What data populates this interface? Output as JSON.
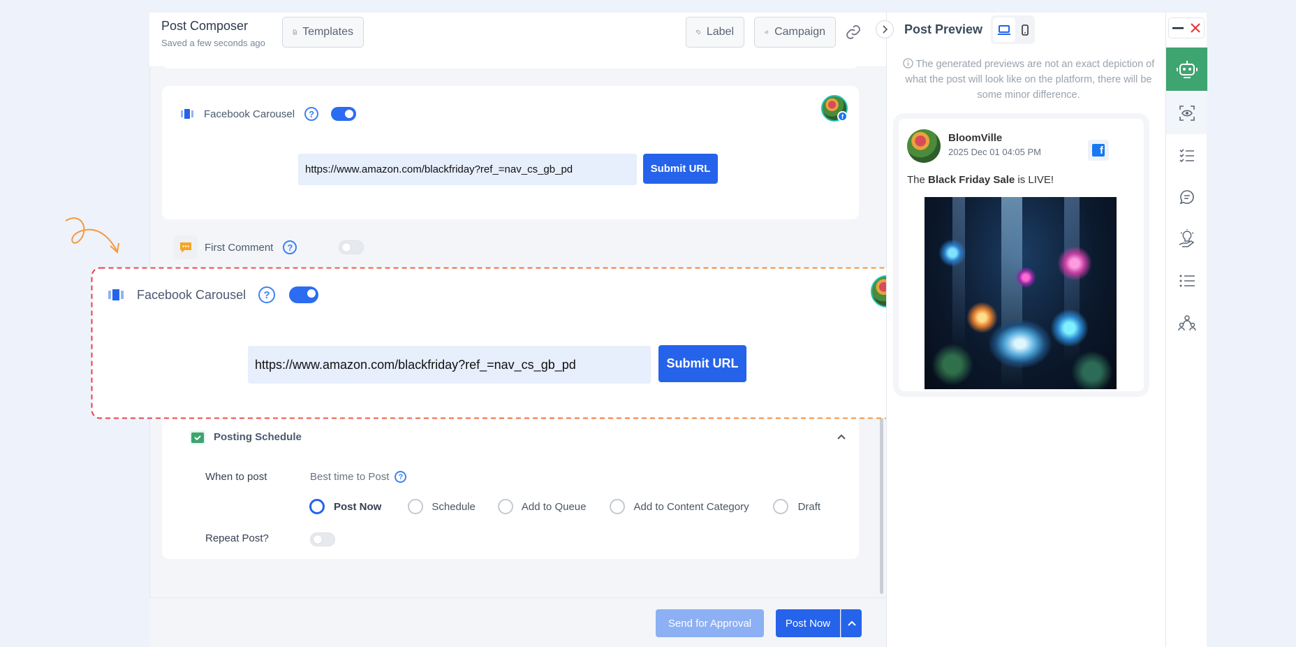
{
  "composer": {
    "title": "Post Composer",
    "saved_status": "Saved a few seconds ago",
    "templates_label": "Templates",
    "label_label": "Label",
    "campaign_label": "Campaign"
  },
  "carousel": {
    "label": "Facebook Carousel",
    "help": "?",
    "url_value": "https://www.amazon.com/blackfriday?ref_=nav_cs_gb_pd",
    "submit_label": "Submit URL",
    "enabled": true
  },
  "first_comment": {
    "label": "First Comment",
    "help": "?",
    "enabled": false
  },
  "schedule": {
    "title": "Posting Schedule",
    "when_label": "When to post",
    "best_time_label": "Best time to Post",
    "help": "?",
    "options": [
      "Post Now",
      "Schedule",
      "Add to Queue",
      "Add to Content Category",
      "Draft"
    ],
    "selected": "Post Now",
    "repeat_label": "Repeat Post?"
  },
  "footer": {
    "approval_label": "Send for Approval",
    "post_now_label": "Post Now"
  },
  "preview": {
    "title": "Post Preview",
    "notice": "The generated previews are not an exact depiction of what the post will look like on the platform, there will be some minor difference.",
    "account_name": "BloomVille",
    "timestamp": "2025 Dec 01 04:05 PM",
    "text_before": "The ",
    "text_bold": "Black Friday Sale",
    "text_after": " is LIVE!"
  },
  "icons": {
    "right_sidebar": [
      "robot-icon",
      "eye-scan-icon",
      "checklist-icon",
      "chat-icon",
      "lightbulb-hand-icon",
      "list-icon",
      "team-icon"
    ]
  },
  "colors": {
    "primary": "#2563eb",
    "accent_dashed_start": "#e8404a",
    "accent_dashed_end": "#f59a3c",
    "bot_green": "#3ea470",
    "close_red": "#e53935"
  }
}
